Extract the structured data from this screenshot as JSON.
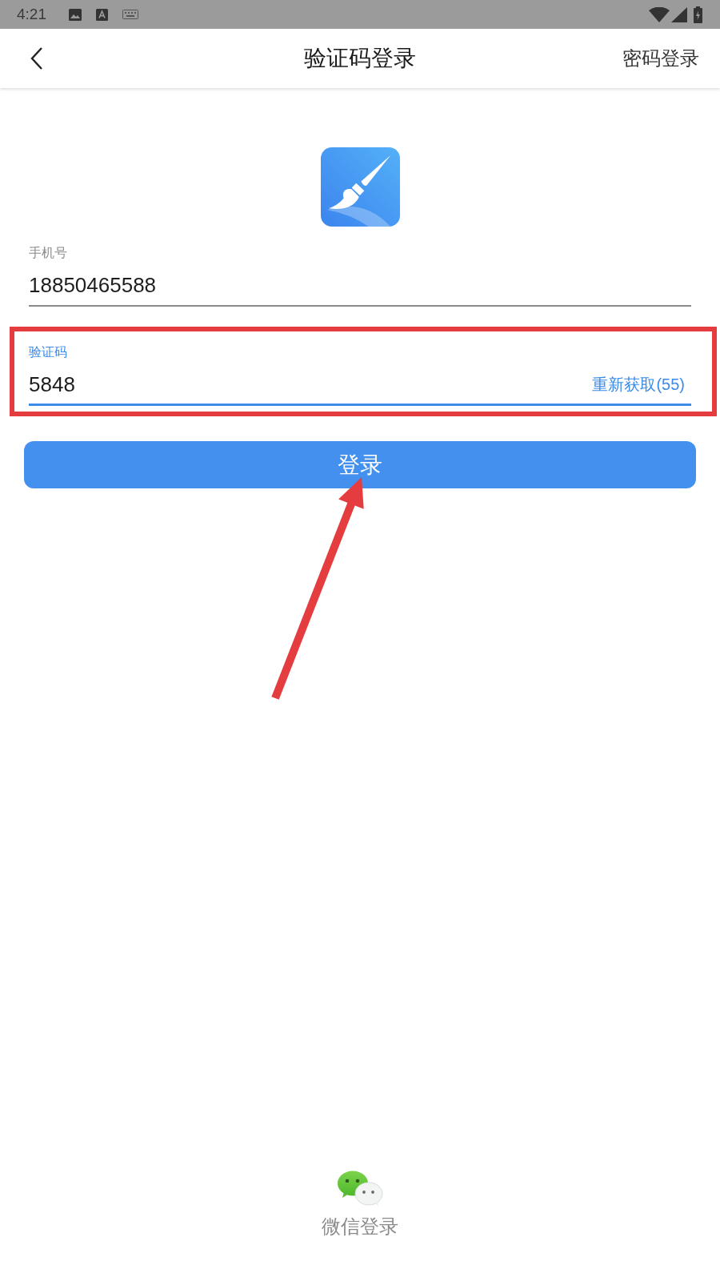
{
  "status_bar": {
    "time": "4:21"
  },
  "header": {
    "title": "验证码登录",
    "action": "密码登录"
  },
  "fields": [
    {
      "label": "手机号",
      "value": "18850465588",
      "focused": false,
      "highlighted": false
    },
    {
      "label": "验证码",
      "value": "5848",
      "focused": true,
      "highlighted": true,
      "resend": "重新获取(55)"
    }
  ],
  "login_button": {
    "label": "登录",
    "pointer_arrow": true
  },
  "alt_login": {
    "label": "微信登录"
  }
}
